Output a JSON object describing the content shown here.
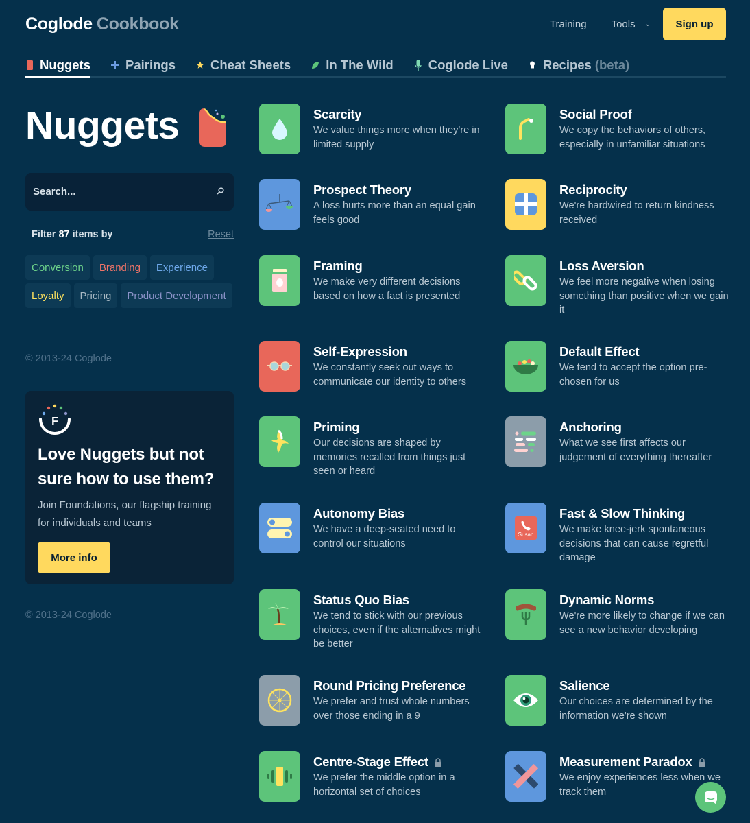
{
  "header": {
    "logo_primary": "Coglode",
    "logo_secondary": "Cookbook",
    "nav": [
      {
        "label": "Training"
      },
      {
        "label": "Tools",
        "icon": "chevron-down-icon"
      }
    ],
    "signup_label": "Sign up"
  },
  "tabs": [
    {
      "label": "Nuggets",
      "icon": "nugget-icon",
      "active": true,
      "icon_color": "#e8675a"
    },
    {
      "label": "Pairings",
      "icon": "plus-icon",
      "icon_color": "#6b9be0"
    },
    {
      "label": "Cheat Sheets",
      "icon": "star-icon",
      "icon_color": "#ffd95e"
    },
    {
      "label": "In The Wild",
      "icon": "leaf-icon",
      "icon_color": "#5dc47a"
    },
    {
      "label": "Coglode Live",
      "icon": "microphone-icon",
      "icon_color": "#7fd9b2"
    },
    {
      "label": "Recipes",
      "suffix": "(beta)",
      "icon": "chef-hat-icon",
      "icon_color": "#ffffff"
    }
  ],
  "sidebar": {
    "title": "Nuggets",
    "search_placeholder": "Search...",
    "filter_prefix": "Filter",
    "filter_count": "87",
    "filter_suffix": "items by",
    "reset_label": "Reset",
    "tags": [
      {
        "label": "Conversion",
        "color": "#6dd38a"
      },
      {
        "label": "Branding",
        "color": "#f07468"
      },
      {
        "label": "Experience",
        "color": "#6ea8ea"
      },
      {
        "label": "Loyalty",
        "color": "#ffe35e"
      },
      {
        "label": "Pricing",
        "color": "#a9b9c4"
      },
      {
        "label": "Product Development",
        "color": "#8c93c9"
      }
    ],
    "copyright": "© 2013-24 Coglode",
    "promo": {
      "title": "Love Nuggets but not sure how to use them?",
      "body": "Join Foundations, our flagship training for individuals and teams",
      "button_label": "More info"
    },
    "copyright_bottom": "© 2013-24 Coglode"
  },
  "nuggets": [
    {
      "name": "Scarcity",
      "desc": "We value things more when they're in limited supply",
      "icon": "water-drop-icon",
      "bg": "#5dc47a"
    },
    {
      "name": "Social Proof",
      "desc": "We copy the behaviors of others, especially in unfamiliar situations",
      "icon": "bent-straw-icon",
      "bg": "#5dc47a"
    },
    {
      "name": "Prospect Theory",
      "desc": "A loss hurts more than an equal gain feels good",
      "icon": "balance-scale-icon",
      "bg": "#5e97dd"
    },
    {
      "name": "Reciprocity",
      "desc": "We're hardwired to return kindness received",
      "icon": "gift-icon",
      "bg": "#ffd95e"
    },
    {
      "name": "Framing",
      "desc": "We make very different decisions based on how a fact is presented",
      "icon": "jar-icon",
      "bg": "#5dc47a"
    },
    {
      "name": "Loss Aversion",
      "desc": "We feel more negative when losing something than positive when we gain it",
      "icon": "chain-link-icon",
      "bg": "#5dc47a"
    },
    {
      "name": "Self-Expression",
      "desc": "We constantly seek out ways to communicate our identity to others",
      "icon": "glasses-icon",
      "bg": "#e8675a"
    },
    {
      "name": "Default Effect",
      "desc": "We tend to accept the option pre-chosen for us",
      "icon": "salad-bowl-icon",
      "bg": "#5dc47a"
    },
    {
      "name": "Priming",
      "desc": "Our decisions are shaped by memories recalled from things just seen or heard",
      "icon": "banana-icon",
      "bg": "#5dc47a"
    },
    {
      "name": "Anchoring",
      "desc": "What we see first affects our judgement of everything thereafter",
      "icon": "code-lines-icon",
      "bg": "#8c9daa"
    },
    {
      "name": "Autonomy Bias",
      "desc": "We have a deep-seated need to control our situations",
      "icon": "toggle-switches-icon",
      "bg": "#5e97dd"
    },
    {
      "name": "Fast & Slow Thinking",
      "desc": "We make knee-jerk spontaneous decisions that can cause regretful damage",
      "icon": "phone-call-icon",
      "bg": "#5e97dd",
      "icon_label": "Susan"
    },
    {
      "name": "Status Quo Bias",
      "desc": "We tend to stick with our previous choices, even if the alternatives might be better",
      "icon": "palm-island-icon",
      "bg": "#5dc47a"
    },
    {
      "name": "Dynamic Norms",
      "desc": "We're more likely to change if we can see a new behavior developing",
      "icon": "sausage-fork-icon",
      "bg": "#5dc47a"
    },
    {
      "name": "Round Pricing Preference",
      "desc": "We prefer and trust whole numbers over those ending in a 9",
      "icon": "wheel-icon",
      "bg": "#8c9daa"
    },
    {
      "name": "Salience",
      "desc": "Our choices are determined by the information we're shown",
      "icon": "eye-icon",
      "bg": "#5dc47a"
    },
    {
      "name": "Centre-Stage Effect",
      "desc": "We prefer the middle option in a horizontal set of choices",
      "icon": "middle-bar-icon",
      "bg": "#5dc47a",
      "locked": true
    },
    {
      "name": "Measurement Paradox",
      "desc": "We enjoy experiences less when we track them",
      "icon": "crossed-rulers-icon",
      "bg": "#5e97dd",
      "locked": true
    }
  ]
}
